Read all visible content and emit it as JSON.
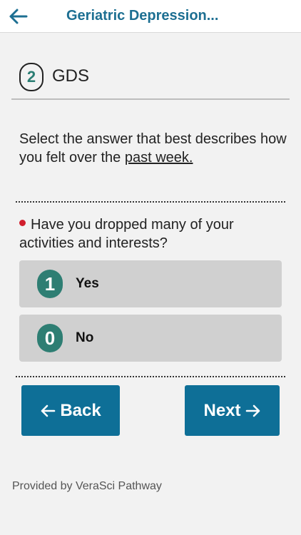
{
  "header": {
    "title": "Geriatric Depression...",
    "back_icon": "arrow-left-icon"
  },
  "step": {
    "number": "2",
    "label": "GDS"
  },
  "instruction": {
    "text": "Select the answer that best describes how you felt over the ",
    "underlined": "past week."
  },
  "question": {
    "text": "Have you dropped many of your activities and interests?"
  },
  "options": [
    {
      "number": "1",
      "label": "Yes"
    },
    {
      "number": "0",
      "label": "No"
    }
  ],
  "nav": {
    "back_label": "Back",
    "next_label": "Next"
  },
  "footer": {
    "text": "Provided by VeraSci Pathway"
  },
  "colors": {
    "primary": "#0e6f97",
    "title": "#1d6f92",
    "badge": "#2e7e73",
    "bullet": "#d11f2d"
  }
}
